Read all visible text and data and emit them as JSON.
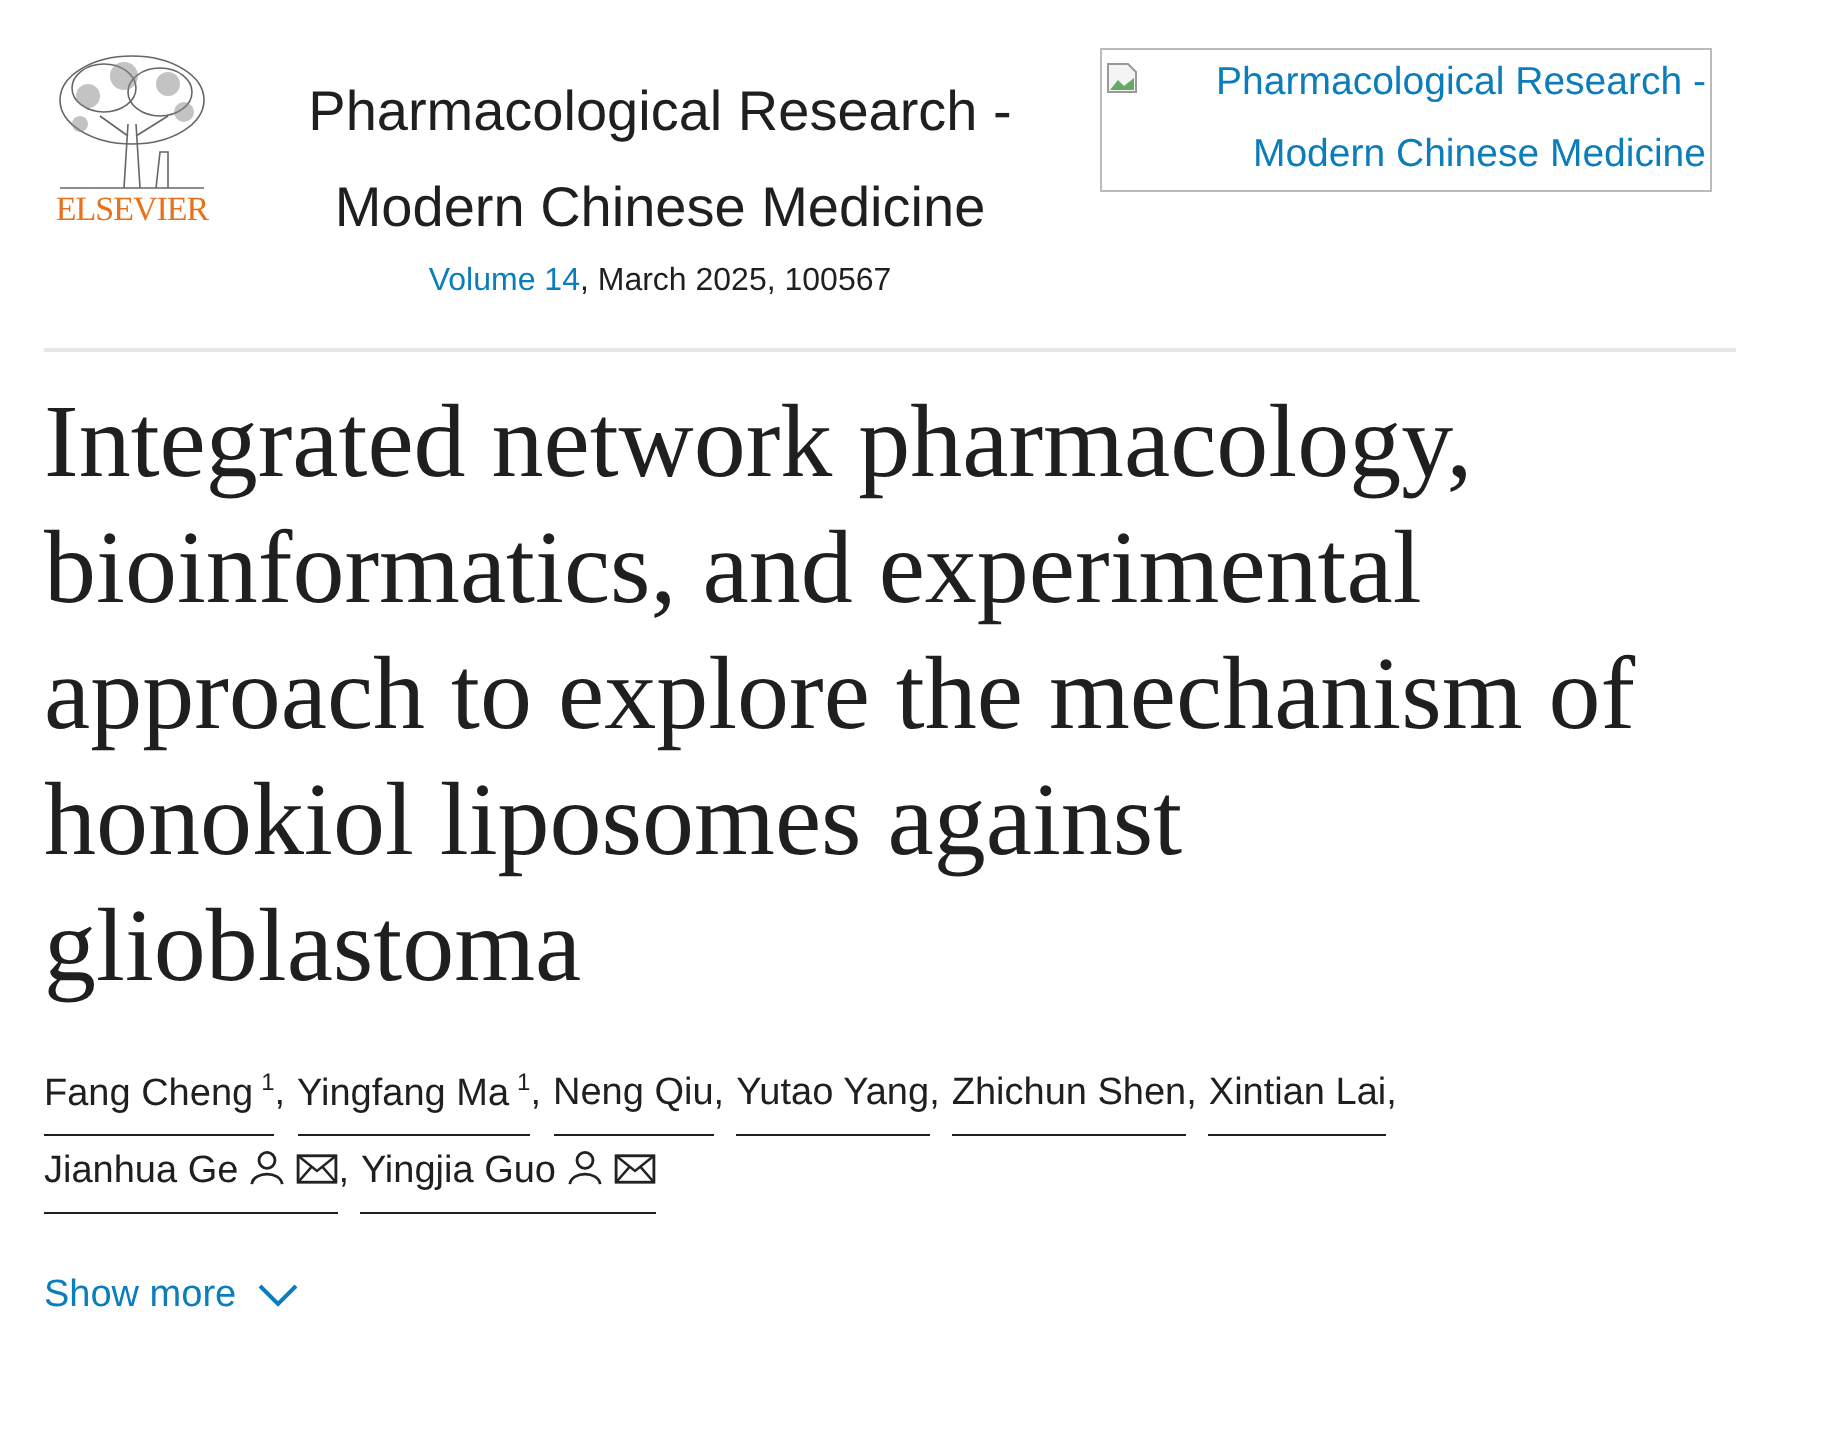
{
  "publisher": {
    "name": "ELSEVIER"
  },
  "journal": {
    "title_lines": [
      "Pharmacological Research -",
      "Modern Chinese Medicine"
    ],
    "volume_link": "Volume 14",
    "citation": ", March 2025, 100567"
  },
  "cover_image": {
    "alt_text": "Pharmacological Research - Modern Chinese Medicine"
  },
  "article_title": "Integrated network pharmacology, bioinformatics, and experimental approach to explore the mechanism of honokiol liposomes against glioblastoma",
  "authors": [
    {
      "name": "Fang Cheng",
      "note": "1",
      "corresponding": false,
      "separator": ","
    },
    {
      "name": "Yingfang Ma",
      "note": "1",
      "corresponding": false,
      "separator": ","
    },
    {
      "name": "Neng Qiu",
      "corresponding": false,
      "separator": ","
    },
    {
      "name": "Yutao Yang",
      "corresponding": false,
      "separator": ","
    },
    {
      "name": "Zhichun Shen",
      "corresponding": false,
      "separator": ","
    },
    {
      "name": "Xintian Lai",
      "corresponding": false,
      "separator": ","
    },
    {
      "name": "Jianhua Ge",
      "corresponding": true,
      "separator": ","
    },
    {
      "name": "Yingjia Guo",
      "corresponding": true
    }
  ],
  "show_more": {
    "label": "Show more",
    "expanded": false
  }
}
